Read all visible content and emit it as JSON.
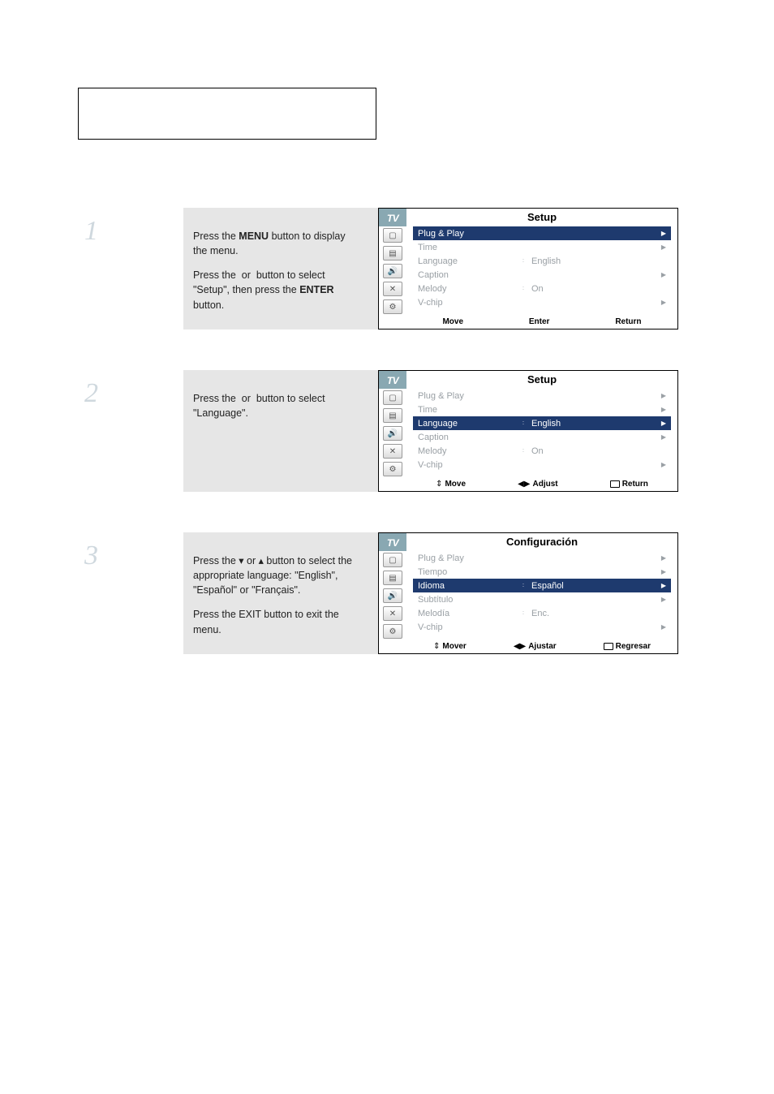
{
  "step1": {
    "num": "1",
    "para1_a": "Press the ",
    "para1_menu": "MENU",
    "para1_b": " button to display the menu.",
    "para2_a": "Press the ",
    "para2_or": " or ",
    "para2_b": " button to select \"Setup\", then press the ",
    "para2_enter": "ENTER",
    "para2_c": " button."
  },
  "step2": {
    "num": "2",
    "para1_a": "Press the ",
    "para1_or": " or ",
    "para1_b": " button to select \"Language\"."
  },
  "step3": {
    "num": "3",
    "para1_a": "Press the ",
    "para1_or": " or ",
    "para1_b": " button to select the appropriate language: \"English\", \"Español\" or \"Français\".",
    "para2": "Press the EXIT button to exit the menu."
  },
  "osd1": {
    "tv": "TV",
    "title": "Setup",
    "rows": [
      {
        "label": "Plug & Play",
        "sep": "",
        "val": "",
        "chev": "▶",
        "sel": true
      },
      {
        "label": "Time",
        "sep": "",
        "val": "",
        "chev": "▶",
        "sel": false
      },
      {
        "label": "Language",
        "sep": ":",
        "val": "English",
        "chev": "",
        "sel": false
      },
      {
        "label": "Caption",
        "sep": "",
        "val": "",
        "chev": "▶",
        "sel": false
      },
      {
        "label": "Melody",
        "sep": ":",
        "val": "On",
        "chev": "",
        "sel": false
      },
      {
        "label": "V-chip",
        "sep": "",
        "val": "",
        "chev": "▶",
        "sel": false
      }
    ],
    "footer": [
      "Move",
      "Enter",
      "Return"
    ]
  },
  "osd2": {
    "tv": "TV",
    "title": "Setup",
    "rows": [
      {
        "label": "Plug & Play",
        "sep": "",
        "val": "",
        "chev": "▶",
        "sel": false
      },
      {
        "label": "Time",
        "sep": "",
        "val": "",
        "chev": "▶",
        "sel": false
      },
      {
        "label": "Language",
        "sep": ":",
        "val": "English",
        "chev": "▶",
        "sel": true
      },
      {
        "label": "Caption",
        "sep": "",
        "val": "",
        "chev": "▶",
        "sel": false
      },
      {
        "label": "Melody",
        "sep": ":",
        "val": "On",
        "chev": "",
        "sel": false
      },
      {
        "label": "V-chip",
        "sep": "",
        "val": "",
        "chev": "▶",
        "sel": false
      }
    ],
    "footer": [
      "Move",
      "Adjust",
      "Return"
    ]
  },
  "osd3": {
    "tv": "TV",
    "title": "Configuración",
    "rows": [
      {
        "label": "Plug & Play",
        "sep": "",
        "val": "",
        "chev": "▶",
        "sel": false
      },
      {
        "label": "Tiempo",
        "sep": "",
        "val": "",
        "chev": "▶",
        "sel": false
      },
      {
        "label": "Idioma",
        "sep": ":",
        "val": "Español",
        "chev": "▶",
        "sel": true
      },
      {
        "label": "Subtítulo",
        "sep": "",
        "val": "",
        "chev": "▶",
        "sel": false
      },
      {
        "label": "Melodía",
        "sep": ":",
        "val": "Enc.",
        "chev": "",
        "sel": false
      },
      {
        "label": "V-chip",
        "sep": "",
        "val": "",
        "chev": "▶",
        "sel": false
      }
    ],
    "footer": [
      "Mover",
      "Ajustar",
      "Regresar"
    ]
  },
  "icons": {
    "updown": "⇕",
    "leftright": "◀▶",
    "menu": "▭"
  }
}
